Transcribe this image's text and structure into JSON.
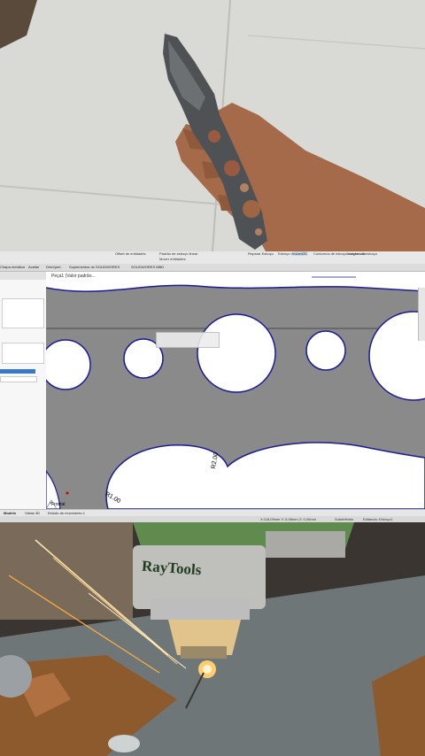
{
  "ribbon": {
    "items": [
      "Offset de entidades",
      "Padrão de esboço linear",
      "Mover entidades",
      "Reparar Esboço",
      "Esboço rápido",
      "Instant2D",
      "Contornos de esboço sombreado",
      "Imagem de esboço"
    ]
  },
  "command_tabs": [
    "Chapa metálica",
    "Avaliar",
    "DimXpert",
    "Suplementos do SOLIDWORKS",
    "SOLIDWORKS MBD"
  ],
  "feature_tree": {
    "root": "Peça1 (Valor padrão..."
  },
  "dimensions": {
    "r_large": "R2.00",
    "r_small": "R1.00"
  },
  "bottom_tabs": [
    "Modelo",
    "Vistas 3D",
    "Estudo de movimento 1"
  ],
  "status_bar": {
    "coords": "X:118,09mm Y:-5,95mm Z: 0,00mm",
    "state": "Subdefinido",
    "editing": "Editando: Esboço1"
  },
  "front_label": "*Frontal",
  "brand_label": "RayTools",
  "colors": {
    "metal_gray": "#8a8a8a",
    "sketch_blue": "#1a1a9a",
    "sparks": "#ffb040"
  }
}
